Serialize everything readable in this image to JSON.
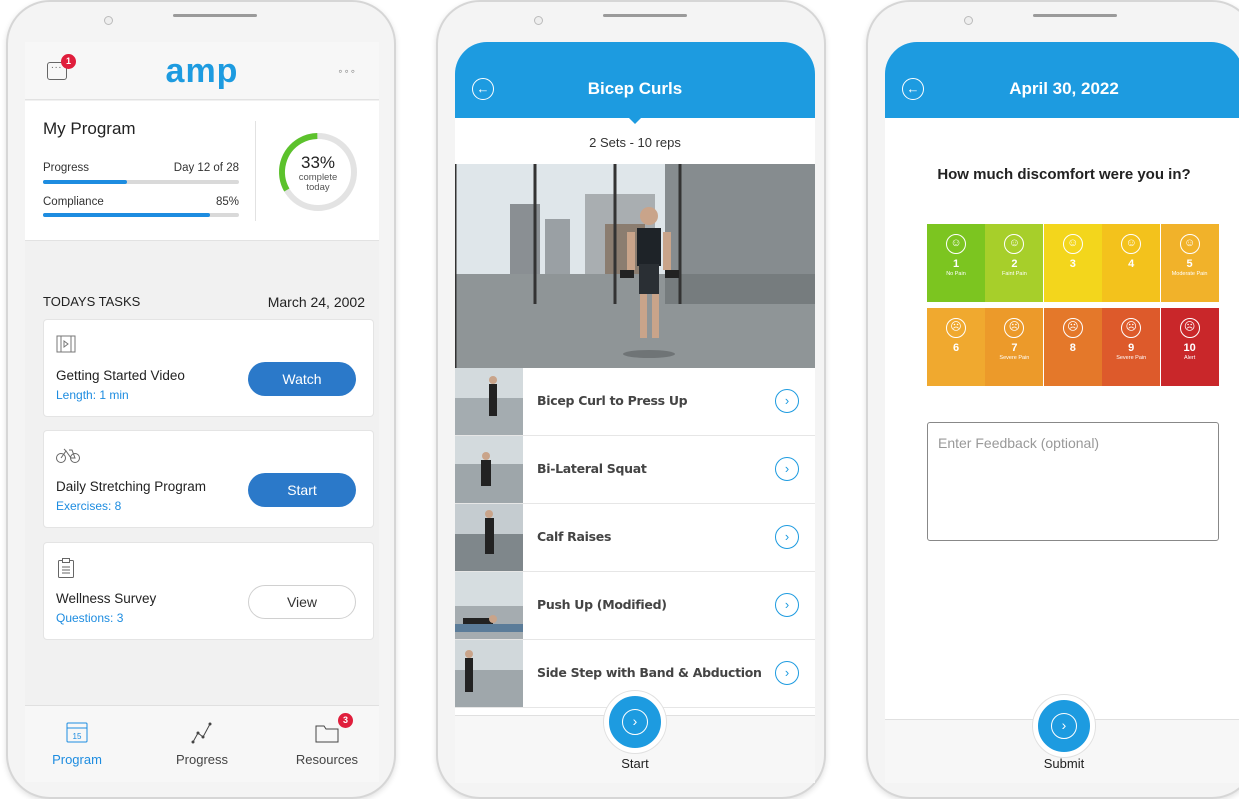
{
  "phone1": {
    "logo": "amp",
    "chat_badge": "1",
    "menu": "◦◦◦",
    "program": {
      "title": "My Program",
      "progress_label": "Progress",
      "progress_value": "Day 12 of 28",
      "progress_fraction": 0.43,
      "compliance_label": "Compliance",
      "compliance_value": "85%",
      "compliance_fraction": 0.85,
      "ring_percent": "33%",
      "ring_line1": "complete",
      "ring_line2": "today",
      "ring_fraction": 0.33
    },
    "tasks_heading": "TODAYS TASKS",
    "tasks_date": "March 24, 2002",
    "tasks": [
      {
        "icon": "video-icon",
        "title": "Getting Started Video",
        "sub": "Length: 1 min",
        "button": "Watch"
      },
      {
        "icon": "bicycle-icon",
        "title": "Daily Stretching Program",
        "sub": "Exercises: 8",
        "button": "Start"
      },
      {
        "icon": "clipboard-icon",
        "title": "Wellness Survey",
        "sub": "Questions: 3",
        "button": "View"
      }
    ],
    "tabs": [
      {
        "label": "Program",
        "icon": "calendar-icon",
        "calendar_day": "15"
      },
      {
        "label": "Progress",
        "icon": "chart-line-icon"
      },
      {
        "label": "Resources",
        "icon": "folder-icon",
        "badge": "3"
      }
    ]
  },
  "phone2": {
    "title": "Bicep Curls",
    "sets": "2 Sets - 10 reps",
    "exercises": [
      "Bicep Curl to Press Up",
      "Bi-Lateral Squat",
      "Calf Raises",
      "Push Up (Modified)",
      "Side Step with Band & Abduction"
    ],
    "button": "Start"
  },
  "phone3": {
    "title": "April 30, 2022",
    "question": "How much discomfort were you in?",
    "scale": [
      {
        "num": "1",
        "label": "No Pain",
        "color": "#7cc520",
        "face": "☺"
      },
      {
        "num": "2",
        "label": "Faint Pain",
        "color": "#a7cf2a",
        "face": "☺"
      },
      {
        "num": "3",
        "label": "",
        "color": "#f3d61c",
        "face": "☺"
      },
      {
        "num": "4",
        "label": "",
        "color": "#f3c21c",
        "face": "☺"
      },
      {
        "num": "5",
        "label": "Moderate Pain",
        "color": "#f1b22a",
        "face": "☺"
      },
      {
        "num": "6",
        "label": "",
        "color": "#f0a92f",
        "face": "☹"
      },
      {
        "num": "7",
        "label": "Severe Pain",
        "color": "#ec9a2a",
        "face": "☹"
      },
      {
        "num": "8",
        "label": "",
        "color": "#e4782a",
        "face": "☹"
      },
      {
        "num": "9",
        "label": "Severe Pain",
        "color": "#dd5a2b",
        "face": "☹"
      },
      {
        "num": "10",
        "label": "Alert",
        "color": "#c9272a",
        "face": "☹"
      }
    ],
    "feedback_placeholder": "Enter Feedback (optional)",
    "button": "Submit"
  }
}
